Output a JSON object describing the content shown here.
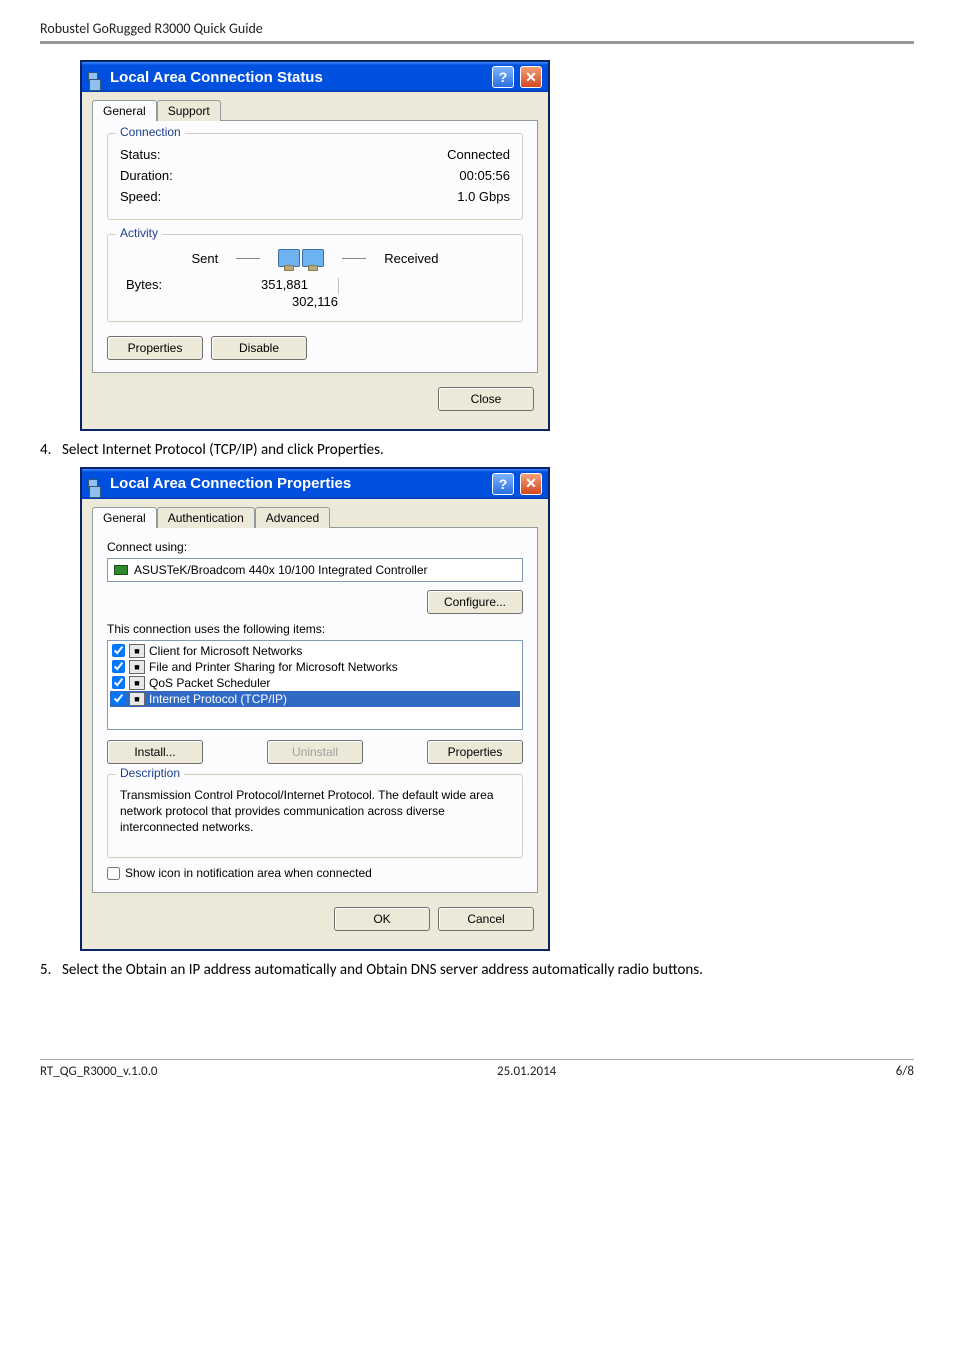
{
  "page": {
    "header": "Robustel GoRugged R3000 Quick Guide",
    "step4": "Select Internet Protocol (TCP/IP) and click Properties.",
    "step5": "Select the Obtain an IP address automatically and Obtain DNS server address automatically radio buttons.",
    "footer_left": "RT_QG_R3000_v.1.0.0",
    "footer_center": "25.01.2014",
    "footer_right": "6/8"
  },
  "dialog1": {
    "title": "Local Area Connection Status",
    "tabs": [
      "General",
      "Support"
    ],
    "connection": {
      "legend": "Connection",
      "status_label": "Status:",
      "status_value": "Connected",
      "duration_label": "Duration:",
      "duration_value": "00:05:56",
      "speed_label": "Speed:",
      "speed_value": "1.0 Gbps"
    },
    "activity": {
      "legend": "Activity",
      "sent": "Sent",
      "received": "Received",
      "bytes_label": "Bytes:",
      "sent_val": "351,881",
      "recv_val": "302,116"
    },
    "buttons": {
      "properties": "Properties",
      "disable": "Disable",
      "close": "Close"
    }
  },
  "dialog2": {
    "title": "Local Area Connection Properties",
    "tabs": [
      "General",
      "Authentication",
      "Advanced"
    ],
    "connect_using": "Connect using:",
    "adapter": "ASUSTeK/Broadcom 440x 10/100 Integrated Controller",
    "configure": "Configure...",
    "uses_label": "This connection uses the following items:",
    "items": [
      {
        "checked": true,
        "label": "Client for Microsoft Networks"
      },
      {
        "checked": true,
        "label": "File and Printer Sharing for Microsoft Networks"
      },
      {
        "checked": true,
        "label": "QoS Packet Scheduler"
      },
      {
        "checked": true,
        "label": "Internet Protocol (TCP/IP)",
        "selected": true
      }
    ],
    "buttons": {
      "install": "Install...",
      "uninstall": "Uninstall",
      "properties": "Properties",
      "ok": "OK",
      "cancel": "Cancel"
    },
    "description": {
      "legend": "Description",
      "text": "Transmission Control Protocol/Internet Protocol. The default wide area network protocol that provides communication across diverse interconnected networks."
    },
    "show_icon": "Show icon in notification area when connected"
  }
}
